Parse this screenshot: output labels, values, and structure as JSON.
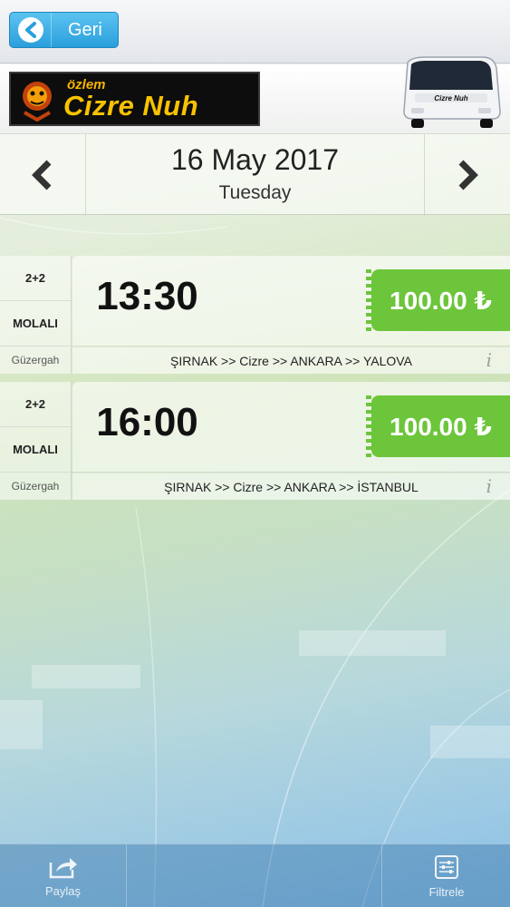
{
  "topbar": {
    "back_label": "Geri"
  },
  "brand": {
    "logo_small": "özlem",
    "logo_big": "Cizre Nuh",
    "bus_text": "Cizre Nuh"
  },
  "date_nav": {
    "date": "16 May 2017",
    "weekday": "Tuesday"
  },
  "trips": [
    {
      "seat_type": "2+2",
      "break_label": "MOLALI",
      "route_label": "Güzergah",
      "time": "13:30",
      "price": "100.00 ₺",
      "route": "ŞIRNAK >> Cizre >> ANKARA >> YALOVA",
      "info": "i"
    },
    {
      "seat_type": "2+2",
      "break_label": "MOLALI",
      "route_label": "Güzergah",
      "time": "16:00",
      "price": "100.00 ₺",
      "route": "ŞIRNAK >> Cizre >> ANKARA >> İSTANBUL",
      "info": "i"
    }
  ],
  "bottombar": {
    "share_label": "Paylaş",
    "filter_label": "Filtrele"
  },
  "colors": {
    "accent_blue": "#2a9fdc",
    "price_green": "#6cc53a",
    "logo_yellow": "#f7c200"
  },
  "icons": [
    "chevron-left-icon",
    "share-icon",
    "filter-icon",
    "info-icon"
  ]
}
